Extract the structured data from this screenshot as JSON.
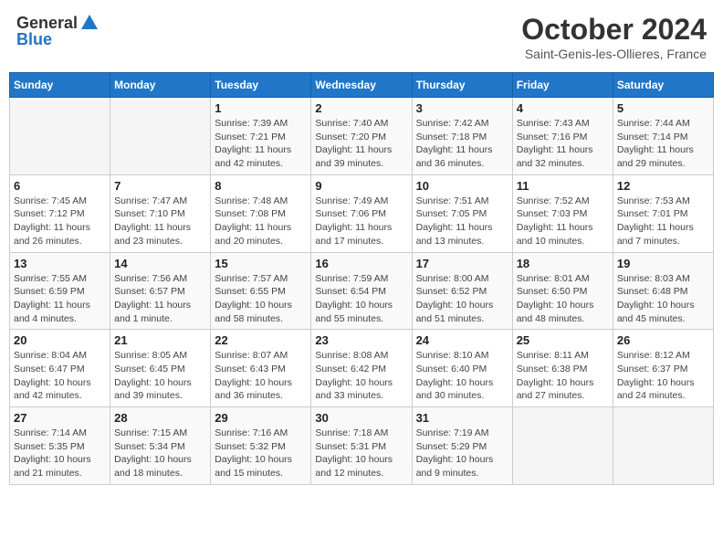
{
  "header": {
    "logo_general": "General",
    "logo_blue": "Blue",
    "month_title": "October 2024",
    "subtitle": "Saint-Genis-les-Ollieres, France"
  },
  "days_of_week": [
    "Sunday",
    "Monday",
    "Tuesday",
    "Wednesday",
    "Thursday",
    "Friday",
    "Saturday"
  ],
  "weeks": [
    [
      {
        "day": "",
        "info": ""
      },
      {
        "day": "",
        "info": ""
      },
      {
        "day": "1",
        "info": "Sunrise: 7:39 AM\nSunset: 7:21 PM\nDaylight: 11 hours and 42 minutes."
      },
      {
        "day": "2",
        "info": "Sunrise: 7:40 AM\nSunset: 7:20 PM\nDaylight: 11 hours and 39 minutes."
      },
      {
        "day": "3",
        "info": "Sunrise: 7:42 AM\nSunset: 7:18 PM\nDaylight: 11 hours and 36 minutes."
      },
      {
        "day": "4",
        "info": "Sunrise: 7:43 AM\nSunset: 7:16 PM\nDaylight: 11 hours and 32 minutes."
      },
      {
        "day": "5",
        "info": "Sunrise: 7:44 AM\nSunset: 7:14 PM\nDaylight: 11 hours and 29 minutes."
      }
    ],
    [
      {
        "day": "6",
        "info": "Sunrise: 7:45 AM\nSunset: 7:12 PM\nDaylight: 11 hours and 26 minutes."
      },
      {
        "day": "7",
        "info": "Sunrise: 7:47 AM\nSunset: 7:10 PM\nDaylight: 11 hours and 23 minutes."
      },
      {
        "day": "8",
        "info": "Sunrise: 7:48 AM\nSunset: 7:08 PM\nDaylight: 11 hours and 20 minutes."
      },
      {
        "day": "9",
        "info": "Sunrise: 7:49 AM\nSunset: 7:06 PM\nDaylight: 11 hours and 17 minutes."
      },
      {
        "day": "10",
        "info": "Sunrise: 7:51 AM\nSunset: 7:05 PM\nDaylight: 11 hours and 13 minutes."
      },
      {
        "day": "11",
        "info": "Sunrise: 7:52 AM\nSunset: 7:03 PM\nDaylight: 11 hours and 10 minutes."
      },
      {
        "day": "12",
        "info": "Sunrise: 7:53 AM\nSunset: 7:01 PM\nDaylight: 11 hours and 7 minutes."
      }
    ],
    [
      {
        "day": "13",
        "info": "Sunrise: 7:55 AM\nSunset: 6:59 PM\nDaylight: 11 hours and 4 minutes."
      },
      {
        "day": "14",
        "info": "Sunrise: 7:56 AM\nSunset: 6:57 PM\nDaylight: 11 hours and 1 minute."
      },
      {
        "day": "15",
        "info": "Sunrise: 7:57 AM\nSunset: 6:55 PM\nDaylight: 10 hours and 58 minutes."
      },
      {
        "day": "16",
        "info": "Sunrise: 7:59 AM\nSunset: 6:54 PM\nDaylight: 10 hours and 55 minutes."
      },
      {
        "day": "17",
        "info": "Sunrise: 8:00 AM\nSunset: 6:52 PM\nDaylight: 10 hours and 51 minutes."
      },
      {
        "day": "18",
        "info": "Sunrise: 8:01 AM\nSunset: 6:50 PM\nDaylight: 10 hours and 48 minutes."
      },
      {
        "day": "19",
        "info": "Sunrise: 8:03 AM\nSunset: 6:48 PM\nDaylight: 10 hours and 45 minutes."
      }
    ],
    [
      {
        "day": "20",
        "info": "Sunrise: 8:04 AM\nSunset: 6:47 PM\nDaylight: 10 hours and 42 minutes."
      },
      {
        "day": "21",
        "info": "Sunrise: 8:05 AM\nSunset: 6:45 PM\nDaylight: 10 hours and 39 minutes."
      },
      {
        "day": "22",
        "info": "Sunrise: 8:07 AM\nSunset: 6:43 PM\nDaylight: 10 hours and 36 minutes."
      },
      {
        "day": "23",
        "info": "Sunrise: 8:08 AM\nSunset: 6:42 PM\nDaylight: 10 hours and 33 minutes."
      },
      {
        "day": "24",
        "info": "Sunrise: 8:10 AM\nSunset: 6:40 PM\nDaylight: 10 hours and 30 minutes."
      },
      {
        "day": "25",
        "info": "Sunrise: 8:11 AM\nSunset: 6:38 PM\nDaylight: 10 hours and 27 minutes."
      },
      {
        "day": "26",
        "info": "Sunrise: 8:12 AM\nSunset: 6:37 PM\nDaylight: 10 hours and 24 minutes."
      }
    ],
    [
      {
        "day": "27",
        "info": "Sunrise: 7:14 AM\nSunset: 5:35 PM\nDaylight: 10 hours and 21 minutes."
      },
      {
        "day": "28",
        "info": "Sunrise: 7:15 AM\nSunset: 5:34 PM\nDaylight: 10 hours and 18 minutes."
      },
      {
        "day": "29",
        "info": "Sunrise: 7:16 AM\nSunset: 5:32 PM\nDaylight: 10 hours and 15 minutes."
      },
      {
        "day": "30",
        "info": "Sunrise: 7:18 AM\nSunset: 5:31 PM\nDaylight: 10 hours and 12 minutes."
      },
      {
        "day": "31",
        "info": "Sunrise: 7:19 AM\nSunset: 5:29 PM\nDaylight: 10 hours and 9 minutes."
      },
      {
        "day": "",
        "info": ""
      },
      {
        "day": "",
        "info": ""
      }
    ]
  ]
}
